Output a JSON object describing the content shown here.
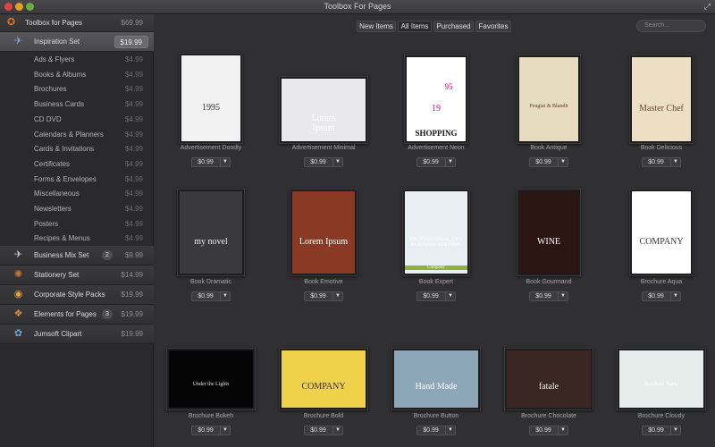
{
  "window": {
    "title": "Toolbox For Pages"
  },
  "sidebar": {
    "top": {
      "label": "Toolbox for Pages",
      "price": "$69.99",
      "icon": "toolbox-icon"
    },
    "sets": [
      {
        "label": "Inspiration Set",
        "price": "$19.99",
        "icon": "rocket-icon",
        "active": true
      }
    ],
    "sub_items": [
      {
        "label": "Ads & Flyers",
        "price": "$4.99"
      },
      {
        "label": "Books & Albums",
        "price": "$4.99"
      },
      {
        "label": "Brochures",
        "price": "$4.99"
      },
      {
        "label": "Business Cards",
        "price": "$4.99"
      },
      {
        "label": "CD DVD",
        "price": "$4.99"
      },
      {
        "label": "Calendars & Planners",
        "price": "$4.99"
      },
      {
        "label": "Cards & Invitations",
        "price": "$4.99"
      },
      {
        "label": "Certificates",
        "price": "$4.99"
      },
      {
        "label": "Forms & Envelopes",
        "price": "$4.99"
      },
      {
        "label": "Miscellaneous",
        "price": "$4.99"
      },
      {
        "label": "Newsletters",
        "price": "$4.99"
      },
      {
        "label": "Posters",
        "price": "$4.99"
      },
      {
        "label": "Recipes & Menus",
        "price": "$4.99"
      }
    ],
    "other_sets": [
      {
        "label": "Business Mix Set",
        "price": "$9.99",
        "badge": "2",
        "icon": "plane-icon"
      },
      {
        "label": "Stationery Set",
        "price": "$14.99",
        "icon": "stamp-icon"
      },
      {
        "label": "Corporate Style Packs",
        "price": "$19.99",
        "icon": "palette-icon"
      },
      {
        "label": "Elements for Pages",
        "price": "$19.99",
        "badge": "3",
        "icon": "elements-icon"
      },
      {
        "label": "Jumsoft Clipart",
        "price": "$19.99",
        "icon": "clipart-icon"
      }
    ]
  },
  "toolbar": {
    "filters": [
      "New Items",
      "All Items",
      "Purchased",
      "Favorites"
    ],
    "active_filter": "All Items",
    "search_placeholder": "Search..."
  },
  "items": [
    {
      "name": "Advertisement Doodly",
      "price": "$0.99",
      "art": {
        "main": "1995"
      }
    },
    {
      "name": "Advertisement Minimal",
      "price": "$0.99",
      "art": {
        "main": "Lorem\nIpsum"
      }
    },
    {
      "name": "Advertisement Neon",
      "price": "$0.99",
      "art": {
        "main": "19",
        "sup": "95",
        "bottom": "SHOPPING"
      }
    },
    {
      "name": "Book Antique",
      "price": "$0.99",
      "art": {
        "main": "Feugiat & Blandit"
      }
    },
    {
      "name": "Book Delicious",
      "price": "$0.99",
      "art": {
        "main": "Master Chef"
      }
    },
    {
      "name": "Book Dramatic",
      "price": "$0.99",
      "art": {
        "main": "my novel"
      }
    },
    {
      "name": "Book Emotive",
      "price": "$0.99",
      "art": {
        "main": "Lorem Ipsum"
      }
    },
    {
      "name": "Book Expert",
      "price": "$0.99",
      "art": {
        "main": "PROFESSIONAL AND BUSINESS SYSTEMS",
        "tag": "Company"
      }
    },
    {
      "name": "Book Gourmand",
      "price": "$0.99",
      "art": {
        "main": "WINE"
      }
    },
    {
      "name": "Brochure Aqua",
      "price": "$0.99",
      "art": {
        "main": "COMPANY"
      }
    },
    {
      "name": "Brochure Bokeh",
      "price": "$0.99",
      "art": {
        "main": "Under the Lights"
      }
    },
    {
      "name": "Brochure Bold",
      "price": "$0.99",
      "art": {
        "main": "COMPANY"
      }
    },
    {
      "name": "Brochure Button",
      "price": "$0.99",
      "art": {
        "main": "Hand Made"
      }
    },
    {
      "name": "Brochure Chocolate",
      "price": "$0.99",
      "art": {
        "main": "fatale"
      }
    },
    {
      "name": "Brochure Cloudy",
      "price": "$0.99",
      "art": {
        "main": "Brochure Name"
      }
    }
  ]
}
